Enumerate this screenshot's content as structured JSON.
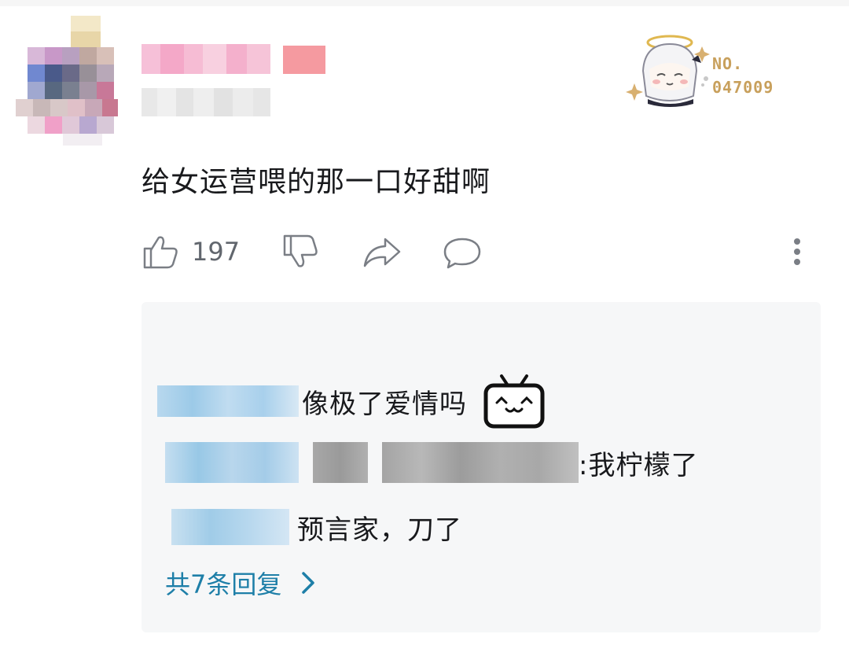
{
  "comment": {
    "text": "给女运营喂的那一口好甜啊",
    "like_count": "197",
    "badge": {
      "label": "NO.",
      "number": "047009"
    }
  },
  "replies": [
    {
      "text": "像极了爱情吗",
      "emoji": "bilibili-tv-emoji"
    },
    {
      "text": ":我柠檬了"
    },
    {
      "text": "预言家，刀了"
    }
  ],
  "more_replies": "共7条回复",
  "icons": [
    "thumbs-up-icon",
    "thumbs-down-icon",
    "share-icon",
    "reply-icon",
    "more-vertical-icon",
    "chevron-right-icon"
  ],
  "colors": {
    "link": "#1e7fa8",
    "text": "#18191c",
    "secondary": "#61666d",
    "reply_bg": "#f6f7f8",
    "badge": "#c8a05c"
  }
}
